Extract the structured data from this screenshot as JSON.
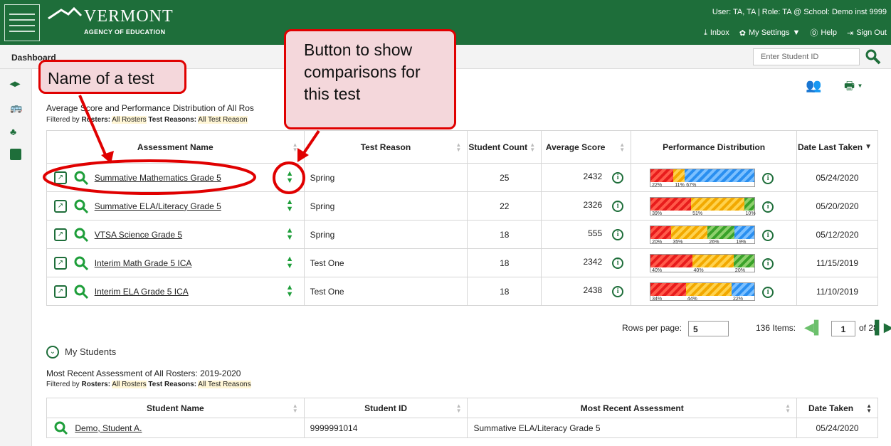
{
  "header": {
    "org": "VERMONT",
    "sub": "AGENCY OF EDUCATION",
    "user": "User: TA, TA  |  Role: TA @ School: Demo inst 9999",
    "inbox": "Inbox",
    "settings": "My Settings",
    "help": "Help",
    "signout": "Sign Out"
  },
  "dashboard": {
    "title": "Dashboard",
    "search_placeholder": "Enter Student ID"
  },
  "section1": {
    "subtitle": "Average Score and Performance Distribution of All Ros",
    "filter_prefix": "Filtered by",
    "rosters_label": "Rosters:",
    "rosters_value": "All Rosters",
    "reasons_label": "Test Reasons:",
    "reasons_value": "All Test Reason"
  },
  "table1": {
    "headers": [
      "Assessment Name",
      "Test Reason",
      "Student Count",
      "Average Score",
      "Performance Distribution",
      "Date Last Taken"
    ],
    "rows": [
      {
        "name": "Summative Mathematics Grade 5",
        "reason": "Spring",
        "count": "25",
        "score": "2432",
        "date": "05/24/2020",
        "dist": [
          [
            "r",
            22,
            "22%"
          ],
          [
            "y",
            11,
            "11%"
          ],
          [
            "b",
            67,
            "67%"
          ]
        ]
      },
      {
        "name": "Summative ELA/Literacy Grade 5",
        "reason": "Spring",
        "count": "22",
        "score": "2326",
        "date": "05/20/2020",
        "dist": [
          [
            "r",
            39,
            "39%"
          ],
          [
            "y",
            51,
            "51%"
          ],
          [
            "g",
            10,
            "10%"
          ]
        ]
      },
      {
        "name": "VTSA Science Grade 5",
        "reason": "Spring",
        "count": "18",
        "score": "555",
        "date": "05/12/2020",
        "dist": [
          [
            "r",
            20,
            "20%"
          ],
          [
            "y",
            35,
            "35%"
          ],
          [
            "g",
            26,
            "26%"
          ],
          [
            "b",
            19,
            "19%"
          ]
        ]
      },
      {
        "name": "Interim Math Grade 5 ICA",
        "reason": "Test One",
        "count": "18",
        "score": "2342",
        "date": "11/15/2019",
        "dist": [
          [
            "r",
            40,
            "40%"
          ],
          [
            "y",
            40,
            "40%"
          ],
          [
            "g",
            20,
            "20%"
          ]
        ]
      },
      {
        "name": "Interim ELA Grade 5 ICA",
        "reason": "Test One",
        "count": "18",
        "score": "2438",
        "date": "11/10/2019",
        "dist": [
          [
            "r",
            34,
            "34%"
          ],
          [
            "y",
            44,
            "44%"
          ],
          [
            "b",
            22,
            "22%"
          ]
        ]
      }
    ]
  },
  "pager": {
    "rows_label": "Rows per page:",
    "rows_value": "5",
    "items": "136 Items:",
    "page": "1",
    "of": "of 28"
  },
  "section2": {
    "title": "My Students",
    "subtitle": "Most Recent Assessment of All Rosters: 2019-2020",
    "filter_prefix": "Filtered by",
    "rosters_label": "Rosters:",
    "rosters_value": "All Rosters",
    "reasons_label": "Test Reasons:",
    "reasons_value": "All Test Reasons"
  },
  "table2": {
    "headers": [
      "Student Name",
      "Student ID",
      "Most Recent Assessment",
      "Date Taken"
    ],
    "rows": [
      {
        "name": "Demo, Student A.",
        "id": "9999991014",
        "assessment": "Summative ELA/Literacy Grade 5",
        "date": "05/24/2020"
      }
    ]
  },
  "callouts": {
    "name": "Name of a test",
    "button": "Button to show comparisons for this test"
  }
}
